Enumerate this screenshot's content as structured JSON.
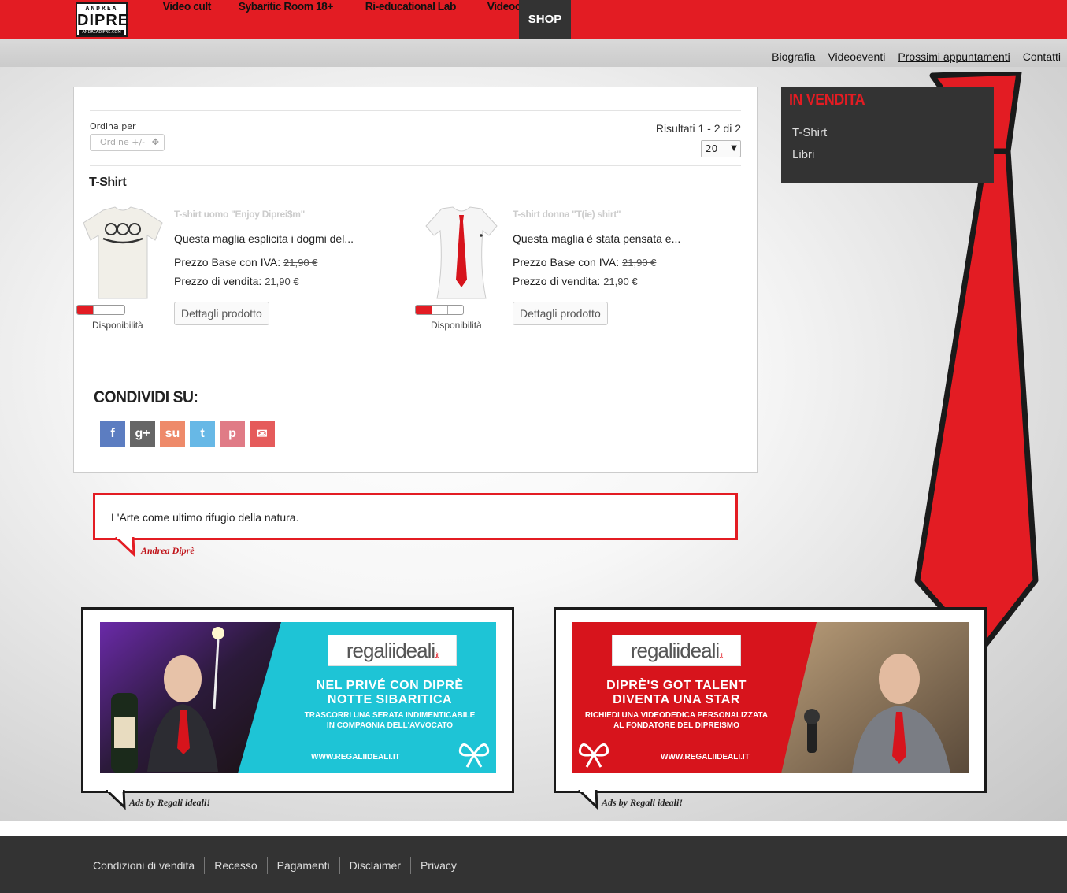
{
  "brand": {
    "top": "ANDREA",
    "name": "DIPRE",
    "sub": "ANDREADIPRE.COM"
  },
  "nav": [
    {
      "label": "Video cult"
    },
    {
      "label": "Sybaritic Room 18+"
    },
    {
      "label": "Ri-educational Lab"
    },
    {
      "label": "Videoclip"
    },
    {
      "label": "SHOP"
    }
  ],
  "subnav": [
    {
      "label": "Biografia"
    },
    {
      "label": "Videoeventi"
    },
    {
      "label": "Prossimi appuntamenti"
    },
    {
      "label": "Contatti"
    }
  ],
  "listing": {
    "order_label": "Ordina per",
    "order_value": "Ordine +/-",
    "results": "Risultati 1 - 2 di 2",
    "per_page": "20",
    "category": "T-Shirt"
  },
  "products": [
    {
      "name": "T-shirt uomo \"Enjoy Diprei$m\"",
      "desc": "Questa maglia esplicita i dogmi del...",
      "base_label": "Prezzo Base con IVA:",
      "base_price": "21,90 €",
      "sale_label": "Prezzo di vendita:",
      "sale_price": "21,90 €",
      "button": "Dettagli prodotto",
      "availability_label": "Disponibilità",
      "availability": 0.33
    },
    {
      "name": "T-shirt donna \"T(ie) shirt\"",
      "desc": "Questa maglia è stata pensata e...",
      "base_label": "Prezzo Base con IVA:",
      "base_price": "21,90 €",
      "sale_label": "Prezzo di vendita:",
      "sale_price": "21,90 €",
      "button": "Dettagli prodotto",
      "availability_label": "Disponibilità",
      "availability": 0.33
    }
  ],
  "share": {
    "title": "CONDIVIDI SU:",
    "icons": [
      {
        "name": "facebook-icon",
        "glyph": "f",
        "color": "#5c7dc1"
      },
      {
        "name": "google-plus-icon",
        "glyph": "g+",
        "color": "#666666"
      },
      {
        "name": "stumbleupon-icon",
        "glyph": "su",
        "color": "#ee8a6a"
      },
      {
        "name": "twitter-icon",
        "glyph": "t",
        "color": "#67b8e6"
      },
      {
        "name": "pinterest-icon",
        "glyph": "p",
        "color": "#e07b86"
      },
      {
        "name": "email-icon",
        "glyph": "✉",
        "color": "#e55b5b"
      }
    ]
  },
  "quote": {
    "text": "L'Arte come ultimo rifugio della natura.",
    "author": "Andrea Diprè"
  },
  "sidebar": {
    "title": "IN VENDITA",
    "items": [
      {
        "label": "T-Shirt"
      },
      {
        "label": "Libri"
      }
    ]
  },
  "ads": [
    {
      "logo": "regaliideali",
      "logo_tld": ".it",
      "headline": "NEL PRIVÉ CON DIPRÈ\nNOTTE SIBARITICA",
      "subline": "TRASCORRI UNA SERATA INDIMENTICABILE\nIN COMPAGNIA DELL'AVVOCATO",
      "url": "WWW.REGALIIDEALI.IT",
      "label": "Ads by Regali ideali!",
      "accent": "#1ec4d6"
    },
    {
      "logo": "regaliideali",
      "logo_tld": ".it",
      "headline": "DIPRÈ'S GOT TALENT\nDIVENTA UNA STAR",
      "subline": "RICHIEDI UNA VIDEODEDICA PERSONALIZZATA\nAL FONDATORE DEL DIPREISMO",
      "url": "WWW.REGALIIDEALI.IT",
      "label": "Ads by Regali ideali!",
      "accent": "#d7141c"
    }
  ],
  "footer": [
    {
      "label": "Condizioni di vendita"
    },
    {
      "label": "Recesso"
    },
    {
      "label": "Pagamenti"
    },
    {
      "label": "Disclaimer"
    },
    {
      "label": "Privacy"
    }
  ],
  "colors": {
    "brand_red": "#e31c23",
    "dark": "#333333"
  }
}
